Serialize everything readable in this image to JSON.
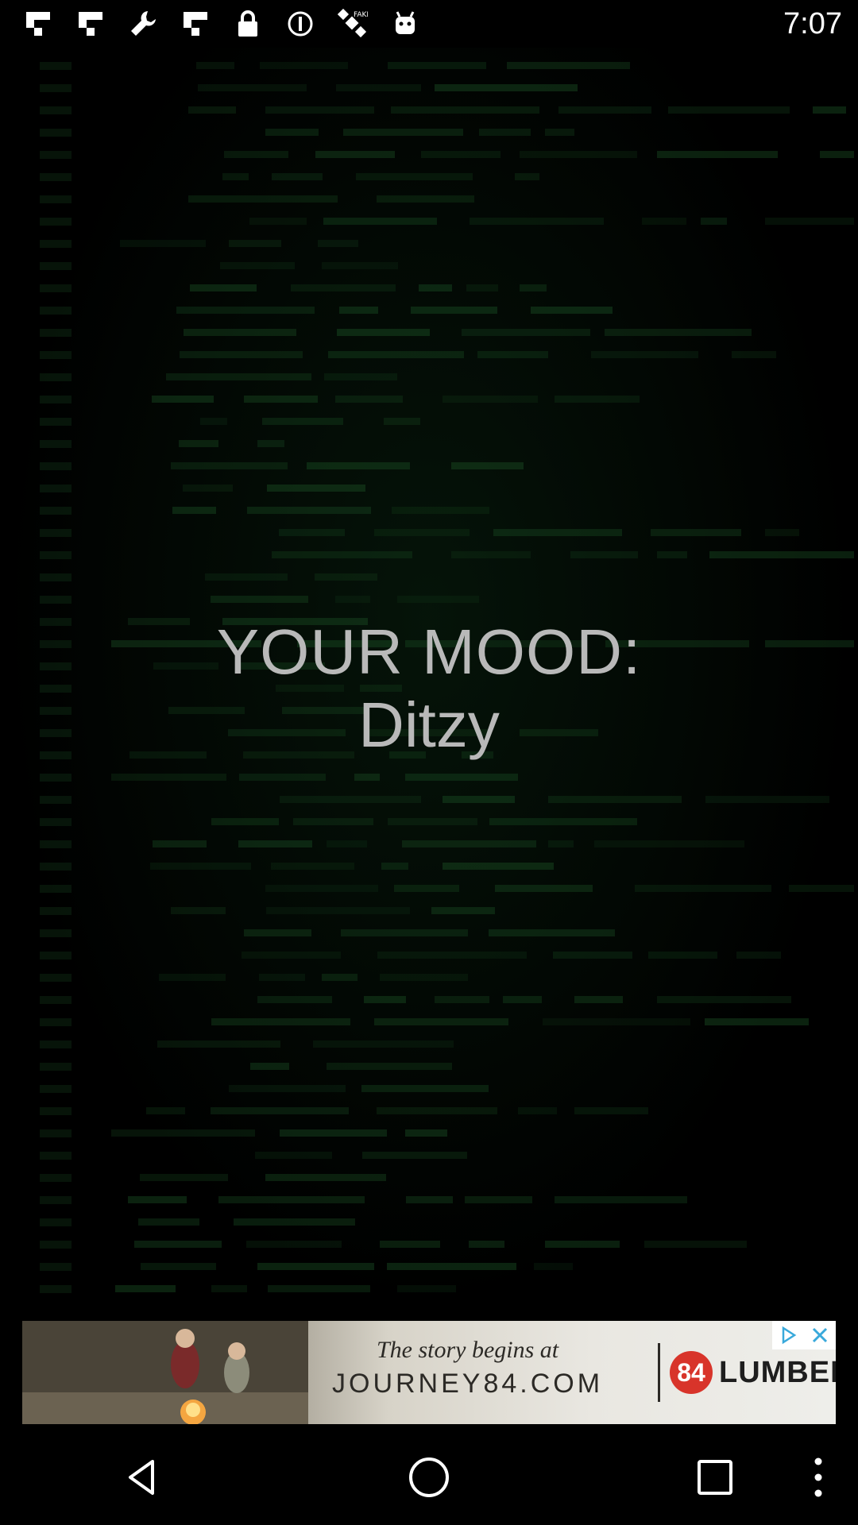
{
  "status_bar": {
    "time": "7:07",
    "icons": [
      "flipboard-icon",
      "flipboard-icon",
      "wrench-icon",
      "flipboard-icon",
      "lock-icon",
      "info-icon",
      "satellite-icon",
      "android-icon"
    ]
  },
  "mood": {
    "title": "YOUR MOOD:",
    "value": "Ditzy"
  },
  "ad": {
    "line1": "The story begins at",
    "line2": "JOURNEY84.COM",
    "logo_badge": "84",
    "logo_text": "LUMBER"
  },
  "colors": {
    "background": "#000000",
    "code_green": "#1f5c2a",
    "mood_text": "#b9b9b9",
    "logo_red": "#d8342a"
  },
  "nav": {
    "icons": [
      "back-icon",
      "home-icon",
      "recents-icon",
      "menu-icon"
    ]
  }
}
